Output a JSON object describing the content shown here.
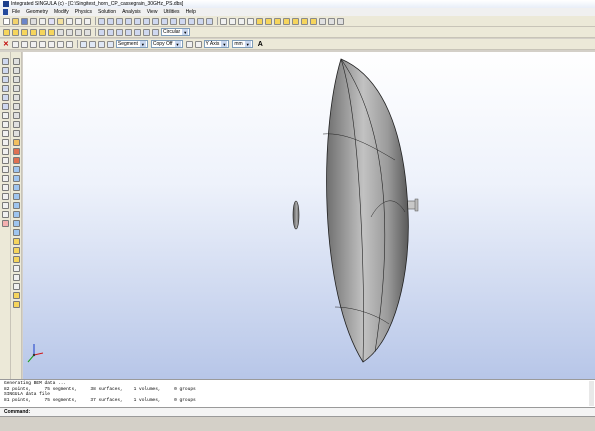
{
  "window": {
    "title": "Integrated SINGULA (c) - [C:\\Singitest_horn_CP_cassegrain_30GHz_PS.dbs]"
  },
  "menu": [
    "File",
    "Geometry",
    "Modify",
    "Physics",
    "Solution",
    "Analysis",
    "View",
    "Utilities",
    "Help"
  ],
  "toolbar2": {
    "view_mode": "Circular"
  },
  "toolbar3": {
    "select_mode": "Segment",
    "copy_mode": "Copy Off",
    "axis": "Y Axis",
    "units": "mm"
  },
  "output": {
    "lines": [
      "Generating BEM data ...",
      "82 points,     75 segments,     38 surfaces,    1 volumes,     0 groups",
      "SINGULA data file",
      "81 points,     75 segments,     37 surfaces,    1 volumes,     0 groups"
    ]
  },
  "command": {
    "label": "Command:"
  },
  "colors": {
    "accent": "#1c3f8c",
    "viewport_top": "#ffffff",
    "viewport_bottom": "#b7c6e8"
  }
}
